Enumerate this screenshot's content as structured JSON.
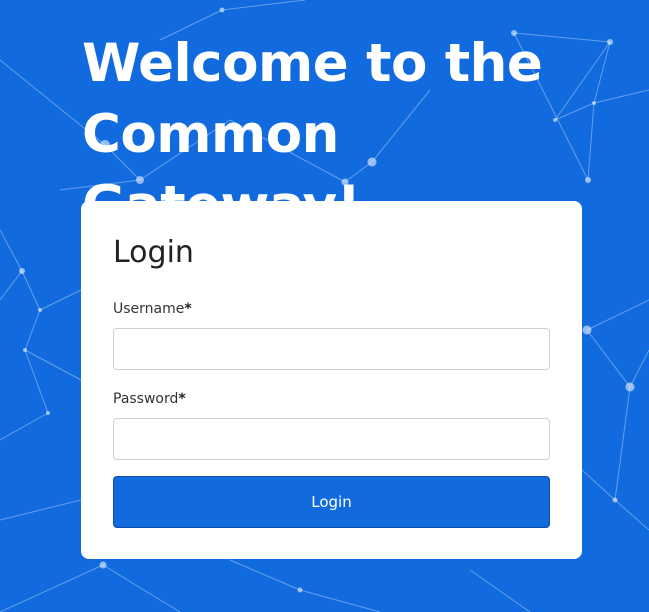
{
  "page": {
    "welcome_title": "Welcome to the Common Gateway!"
  },
  "login_form": {
    "heading": "Login",
    "username_label": "Username",
    "password_label": "Password",
    "required_marker": "*",
    "username_value": "",
    "password_value": "",
    "submit_label": "Login"
  },
  "colors": {
    "background": "#126bde",
    "card": "#ffffff",
    "button": "#126bde",
    "button_text": "#ffffff"
  },
  "icons": {
    "background_pattern": "network-nodes-pattern"
  }
}
